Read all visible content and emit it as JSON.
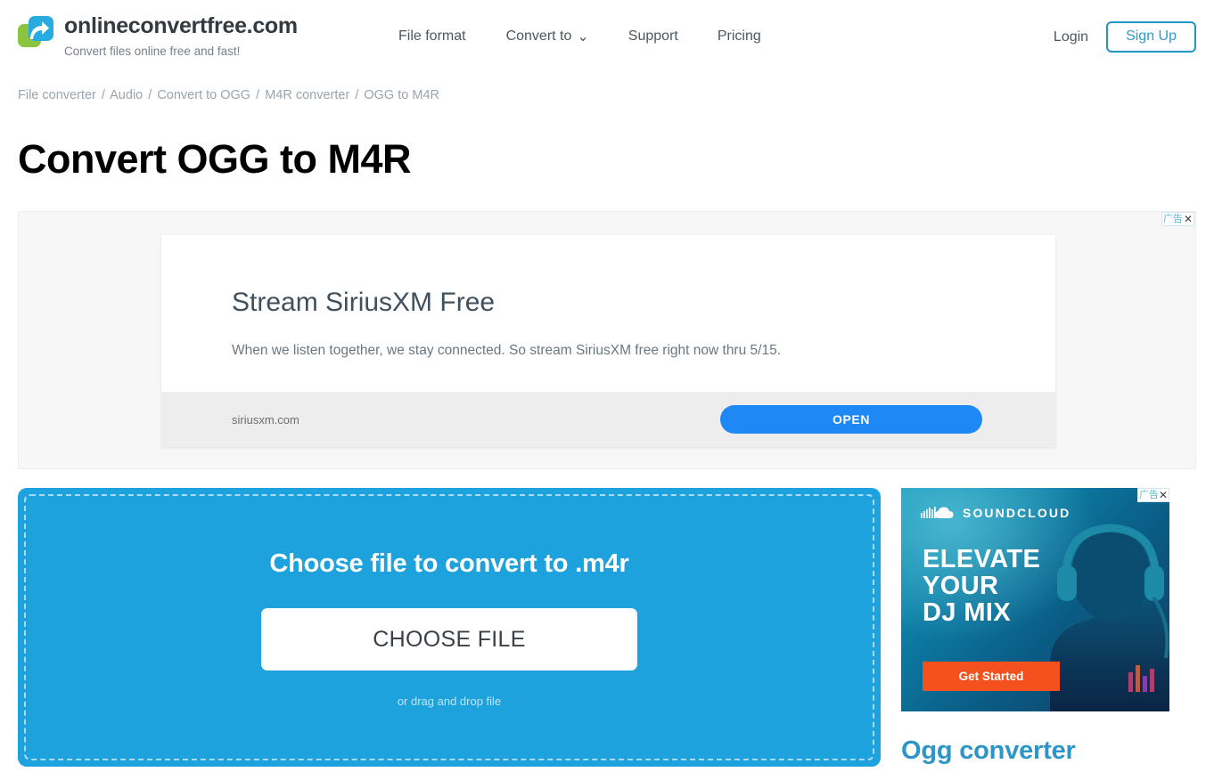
{
  "header": {
    "logo_icon": "convert-arrow-logo",
    "brand_title": "onlineconvertfree.com",
    "brand_tagline": "Convert files online free and fast!",
    "nav": [
      {
        "label": "File format",
        "name": "file-format",
        "has_chevron": false
      },
      {
        "label": "Convert to",
        "name": "convert-to",
        "has_chevron": true
      },
      {
        "label": "Support",
        "name": "support",
        "has_chevron": false
      },
      {
        "label": "Pricing",
        "name": "pricing",
        "has_chevron": false
      }
    ],
    "chevron_glyph": "⌄",
    "login_label": "Login",
    "signup_label": "Sign Up",
    "accent_color": "#2e9bc9"
  },
  "breadcrumb": {
    "items": [
      "File converter",
      "Audio",
      "Convert to OGG",
      "M4R converter",
      "OGG to M4R"
    ],
    "separator": "/"
  },
  "page": {
    "title": "Convert OGG to M4R"
  },
  "top_ad": {
    "ad_label": "广告",
    "close_glyph": "✕",
    "headline": "Stream SiriusXM Free",
    "description": "When we listen together, we stay connected. So stream SiriusXM free right now thru 5/15.",
    "url": "siriusxm.com",
    "cta_label": "OPEN",
    "cta_color": "#1e88f5"
  },
  "dropzone": {
    "title": "Choose file to convert to .m4r",
    "button_label": "CHOOSE FILE",
    "hint": "or drag and drop file",
    "background_color": "#1ea2dd"
  },
  "sidebar": {
    "ad": {
      "ad_label": "广告",
      "close_glyph": "✕",
      "brand": "SOUNDCLOUD",
      "brand_icon": "soundcloud-cloud-icon",
      "headline_line1": "ELEVATE",
      "headline_line2": "YOUR",
      "headline_line3": "DJ MIX",
      "cta_label": "Get Started",
      "cta_color": "#f4511e"
    },
    "heading": "Ogg converter",
    "heading_color": "#2e95c9"
  }
}
